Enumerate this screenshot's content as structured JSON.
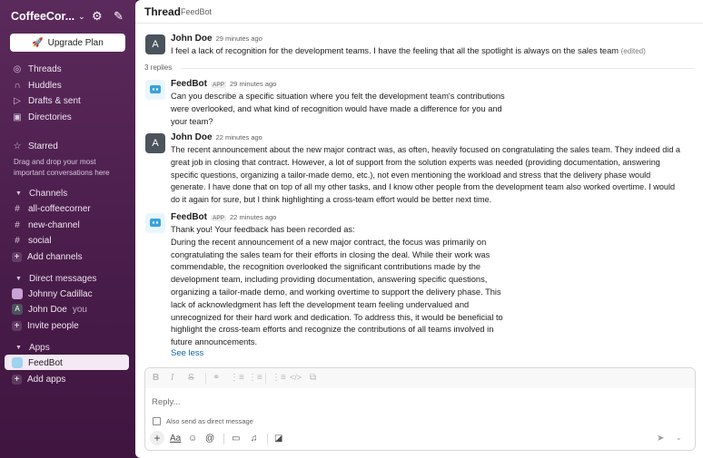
{
  "workspace": {
    "name": "CoffeeCor..."
  },
  "sidebar": {
    "upgrade_label": "Upgrade Plan",
    "nav": [
      {
        "label": "Threads",
        "icon": "threads-icon"
      },
      {
        "label": "Huddles",
        "icon": "headphones-icon"
      },
      {
        "label": "Drafts & sent",
        "icon": "send-icon"
      },
      {
        "label": "Directories",
        "icon": "directory-icon"
      }
    ],
    "starred_label": "Starred",
    "starred_hint": "Drag and drop your most important conversations here",
    "channels_label": "Channels",
    "channels": [
      "all-coffeecorner",
      "new-channel",
      "social"
    ],
    "add_channels": "Add channels",
    "dm_label": "Direct messages",
    "dms": [
      {
        "name": "Johnny Cadillac",
        "suffix": ""
      },
      {
        "name": "John Doe",
        "suffix": "you"
      }
    ],
    "invite_people": "Invite people",
    "apps_label": "Apps",
    "apps": [
      "FeedBot"
    ],
    "add_apps": "Add apps"
  },
  "thread": {
    "title": "Thread",
    "subtitle": "FeedBot",
    "replies_label": "3 replies",
    "messages": [
      {
        "author": "John Doe",
        "avatar": "A",
        "app": "",
        "time": "29 minutes ago",
        "lines": [
          "I feel a lack of recognition for the development teams. I have the feeling that all the spotlight is always on the sales team"
        ],
        "edited": "(edited)"
      },
      {
        "author": "FeedBot",
        "app": "APP",
        "time": "29 minutes ago",
        "lines": [
          "Can you describe a specific situation where you felt the development team's contributions",
          "were overlooked, and what kind of recognition would have made a difference for you and",
          "your team?"
        ]
      },
      {
        "author": "John Doe",
        "avatar": "A",
        "app": "",
        "time": "22 minutes ago",
        "lines": [
          "The recent announcement about the new major contract was, as often, heavily focused on congratulating the sales team. They indeed did a",
          "great job in closing that contract. However, a lot of support from the solution experts was needed (providing documentation, answering",
          "specific questions, organizing a tailor-made demo, etc.), not even mentioning the workload and stress that the delivery phase would",
          "generate. I have done that on top of all my other tasks, and I know other people from the development team also worked overtime. I would",
          "do it again for sure, but I think highlighting a cross-team effort would be better next time."
        ]
      },
      {
        "author": "FeedBot",
        "app": "APP",
        "time": "22 minutes ago",
        "lines": [
          "Thank you! Your feedback has been recorded as:",
          "During the recent announcement of a new major contract, the focus was primarily on",
          "congratulating the sales team for their efforts in closing the deal. While their work was",
          "commendable, the recognition overlooked the significant contributions made by the",
          "development team, including providing documentation, answering specific questions,",
          "organizing a tailor-made demo, and working overtime to support the delivery phase. This",
          "lack of acknowledgment has left the development team feeling undervalued and",
          "unrecognized for their hard work and dedication. To address this, it would be beneficial to",
          "highlight the cross-team efforts and recognize the contributions of all teams involved in",
          "future announcements."
        ]
      }
    ],
    "see_less": "See less"
  },
  "composer": {
    "placeholder": "Reply...",
    "also_send": "Also send as direct message",
    "format_label": "Aa"
  },
  "colors": {
    "sidebar": "#4a1d4b",
    "link": "#1264a3",
    "accent": "#611f69"
  }
}
